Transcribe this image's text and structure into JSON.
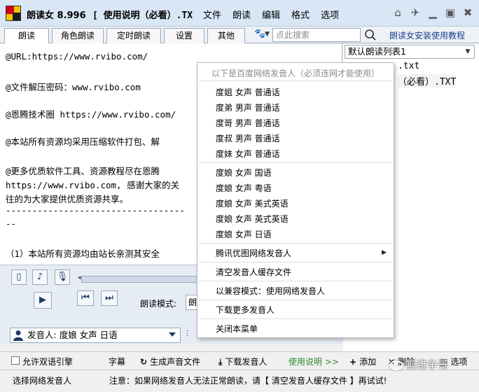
{
  "window": {
    "app_name": "朗读女 8.996",
    "doc_title": "[ 使用说明（必看）.TX",
    "menu": [
      "文件",
      "朗读",
      "编辑",
      "格式",
      "选项"
    ]
  },
  "tabs": {
    "items": [
      "朗读",
      "角色朗读",
      "定时朗读",
      "设置",
      "其他"
    ],
    "active": "朗读"
  },
  "search": {
    "placeholder": "点此搜索"
  },
  "install_link": "朗读女安装使用教程",
  "editor": {
    "lines": [
      "@URL:https://www.rvibo.com/",
      "@文件解压密码：www.rvibo.com",
      "@恩腾技术圈 https://www.rvibo.com/",
      "@本站所有资源均采用压缩软件打包、解",
      "@更多优质软件工具、资源教程尽在恩腾",
      "https://www.rvibo.com, 感谢大家的关",
      "往的为大家提供优质资源共享。",
      "----------------------------------",
      "--",
      "（1）本站所有资源均由站长亲测其安全"
    ]
  },
  "playlist": {
    "selected": "默认朗读列表1",
    "items": [
      ".txt",
      "（必看）.TXT"
    ]
  },
  "player": {
    "mode_label": "朗读模式:",
    "mode_value": "朗"
  },
  "voice": {
    "label": "发音人:",
    "value": "度娘 女声 日语"
  },
  "context_menu": {
    "header": "以下是百度网络发音人（必须连网才能使用）",
    "group1": [
      "度姐 女声 普通话",
      "度弟 男声 普通话",
      "度哥 男声 普通话",
      "度叔 男声 普通话",
      "度妹 女声 普通话"
    ],
    "group2": [
      "度娘 女声 国语",
      "度娘 女声 粤语",
      "度娘 女声 美式英语",
      "度娘 女声 英式英语",
      "度娘 女声 日语"
    ],
    "tencent": "腾讯优图网络发音人",
    "clear_cache": "清空发音人缓存文件",
    "compat_mode": "以兼容模式：使用网络发音人",
    "download_more": "下载更多发音人",
    "close": "关闭本菜单"
  },
  "actions": {
    "dual_engine": "允许双语引擎",
    "subtitles": "字幕",
    "gen_audio": "生成声音文件",
    "download_voice": "下载发音人",
    "usage": "使用说明 >>",
    "add": "添加",
    "delete": "删除",
    "options": "选项"
  },
  "status": {
    "left": "选择网络发音人",
    "note": "注意：如果网络发音人无法正常朗读，请【 清空发音人缓存文件 】再试试!"
  },
  "watermark": "斯维争哥"
}
